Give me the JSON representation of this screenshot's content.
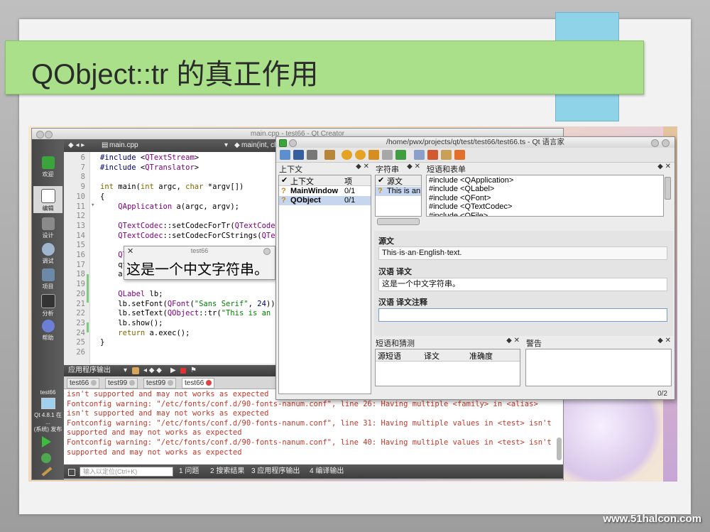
{
  "slide": {
    "title": "QObject::tr 的真正作用",
    "watermark": "www.51halcon.com"
  },
  "qtcreator": {
    "window_title": "main.cpp - test66 - Qt Creator",
    "file_tab": "main.cpp",
    "function_tab": "main(int, ch",
    "sidebar": [
      {
        "label": "欢迎",
        "icon": "qt-logo-icon"
      },
      {
        "label": "编辑",
        "icon": "edit-icon"
      },
      {
        "label": "设计",
        "icon": "design-icon"
      },
      {
        "label": "调试",
        "icon": "debug-icon"
      },
      {
        "label": "项目",
        "icon": "project-icon"
      },
      {
        "label": "分析",
        "icon": "analyze-icon"
      },
      {
        "label": "帮助",
        "icon": "help-icon"
      }
    ],
    "target": {
      "project": "test66",
      "kit": "Qt 4.8.1 在 ...",
      "kit2": "(系统) 发布"
    },
    "code_lines": [
      {
        "n": "6",
        "t": "#include <QTextStream>"
      },
      {
        "n": "7",
        "t": "#include <QTranslator>"
      },
      {
        "n": "8",
        "t": ""
      },
      {
        "n": "9",
        "t": "int main(int argc, char *argv[])"
      },
      {
        "n": "10",
        "t": "{"
      },
      {
        "n": "11",
        "t": "    QApplication a(argc, argv);"
      },
      {
        "n": "12",
        "t": ""
      },
      {
        "n": "13",
        "t": "    QTextCodec::setCodecForTr(QTextCodec"
      },
      {
        "n": "14",
        "t": "    QTextCodec::setCodecForCStrings(QTex"
      },
      {
        "n": "15",
        "t": ""
      },
      {
        "n": "16",
        "t": "    QT"
      },
      {
        "n": "17",
        "t": "    qt"
      },
      {
        "n": "18",
        "t": "    a."
      },
      {
        "n": "19",
        "t": ""
      },
      {
        "n": "20",
        "t": "    QLabel lb;"
      },
      {
        "n": "21",
        "t": "    lb.setFont(QFont(\"Sans Serif\", 24));"
      },
      {
        "n": "22",
        "t": "    lb.setText(QObject::tr(\"This is an E"
      },
      {
        "n": "23",
        "t": "    lb.show();"
      },
      {
        "n": "24",
        "t": "    return a.exec();"
      },
      {
        "n": "25",
        "t": "}"
      },
      {
        "n": "26",
        "t": ""
      }
    ],
    "output_header": "应用程序输出",
    "output_tabs": [
      "test66",
      "test99",
      "test99",
      "test66"
    ],
    "output_lines": [
      "isn't supported and may not works as expected",
      "Fontconfig warning: \"/etc/fonts/conf.d/90-fonts-nanum.conf\", line 26: Having multiple <family> in <alias>",
      "isn't supported and may not works as expected",
      "Fontconfig warning: \"/etc/fonts/conf.d/90-fonts-nanum.conf\", line 31: Having multiple values in <test> isn't",
      "supported and may not works as expected",
      "Fontconfig warning: \"/etc/fonts/conf.d/90-fonts-nanum.conf\", line 40: Having multiple values in <test> isn't",
      "supported and may not works as expected"
    ],
    "statusbar": {
      "locator_placeholder": "输入以定位(Ctrl+K)",
      "buttons": [
        "1 问题",
        "2 搜索结果",
        "3 应用程序输出",
        "4 编译输出"
      ]
    }
  },
  "test_window": {
    "title": "test66",
    "text": "这是一个中文字符串。"
  },
  "linguist": {
    "window_title": "/home/pwx/projects/qt/test/test66/test66.ts - Qt 语言家",
    "context_panel": {
      "title": "上下文",
      "columns": [
        "上下文",
        "项"
      ],
      "rows": [
        {
          "name": "MainWindow",
          "count": "0/1"
        },
        {
          "name": "QObject",
          "count": "0/1"
        }
      ]
    },
    "strings_panel": {
      "title": "字符串",
      "columns": [
        "源文"
      ],
      "rows": [
        "This is an"
      ]
    },
    "phrases_panel": {
      "title": "短语和表单",
      "lines": [
        "#include <QApplication>",
        "#include <QLabel>",
        "#include <QFont>",
        "#include <QTextCodec>",
        "#include <QFile>"
      ]
    },
    "source_label": "源文",
    "source_text": "This·is·an·English·text.",
    "translation_label": "汉语 译文",
    "translation_text": "这是一个中文字符串。",
    "comment_label": "汉语 译文注释",
    "comment_text": "",
    "guess_panel": {
      "title": "短语和猜测",
      "columns": [
        "源短语",
        "译文",
        "准确度"
      ]
    },
    "warnings_panel": {
      "title": "警告"
    },
    "progress": "0/2"
  }
}
